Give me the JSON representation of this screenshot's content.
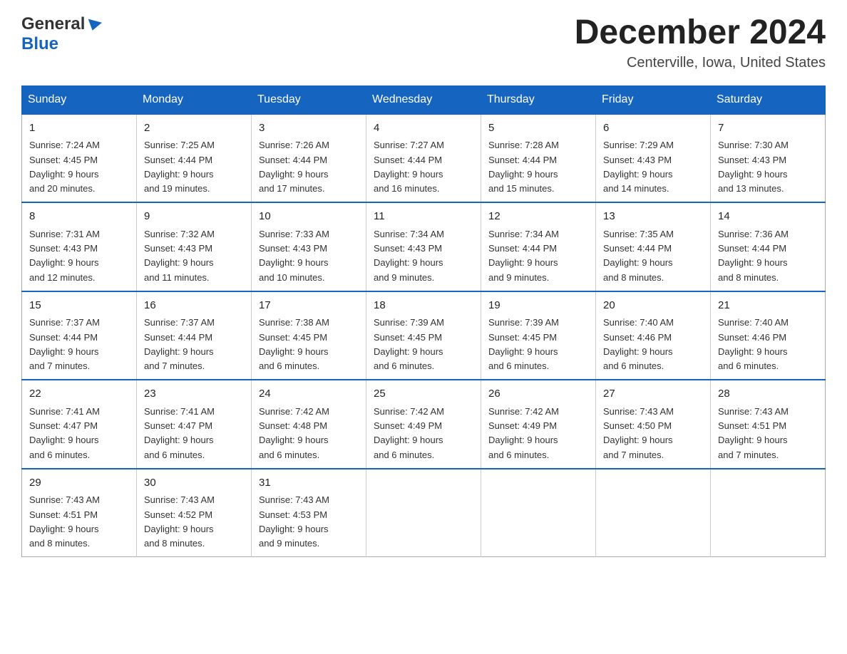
{
  "header": {
    "logo_general": "General",
    "logo_blue": "Blue",
    "month_title": "December 2024",
    "location": "Centerville, Iowa, United States"
  },
  "days_of_week": [
    "Sunday",
    "Monday",
    "Tuesday",
    "Wednesday",
    "Thursday",
    "Friday",
    "Saturday"
  ],
  "weeks": [
    [
      {
        "day": "1",
        "sunrise": "7:24 AM",
        "sunset": "4:45 PM",
        "daylight": "9 hours and 20 minutes."
      },
      {
        "day": "2",
        "sunrise": "7:25 AM",
        "sunset": "4:44 PM",
        "daylight": "9 hours and 19 minutes."
      },
      {
        "day": "3",
        "sunrise": "7:26 AM",
        "sunset": "4:44 PM",
        "daylight": "9 hours and 17 minutes."
      },
      {
        "day": "4",
        "sunrise": "7:27 AM",
        "sunset": "4:44 PM",
        "daylight": "9 hours and 16 minutes."
      },
      {
        "day": "5",
        "sunrise": "7:28 AM",
        "sunset": "4:44 PM",
        "daylight": "9 hours and 15 minutes."
      },
      {
        "day": "6",
        "sunrise": "7:29 AM",
        "sunset": "4:43 PM",
        "daylight": "9 hours and 14 minutes."
      },
      {
        "day": "7",
        "sunrise": "7:30 AM",
        "sunset": "4:43 PM",
        "daylight": "9 hours and 13 minutes."
      }
    ],
    [
      {
        "day": "8",
        "sunrise": "7:31 AM",
        "sunset": "4:43 PM",
        "daylight": "9 hours and 12 minutes."
      },
      {
        "day": "9",
        "sunrise": "7:32 AM",
        "sunset": "4:43 PM",
        "daylight": "9 hours and 11 minutes."
      },
      {
        "day": "10",
        "sunrise": "7:33 AM",
        "sunset": "4:43 PM",
        "daylight": "9 hours and 10 minutes."
      },
      {
        "day": "11",
        "sunrise": "7:34 AM",
        "sunset": "4:43 PM",
        "daylight": "9 hours and 9 minutes."
      },
      {
        "day": "12",
        "sunrise": "7:34 AM",
        "sunset": "4:44 PM",
        "daylight": "9 hours and 9 minutes."
      },
      {
        "day": "13",
        "sunrise": "7:35 AM",
        "sunset": "4:44 PM",
        "daylight": "9 hours and 8 minutes."
      },
      {
        "day": "14",
        "sunrise": "7:36 AM",
        "sunset": "4:44 PM",
        "daylight": "9 hours and 8 minutes."
      }
    ],
    [
      {
        "day": "15",
        "sunrise": "7:37 AM",
        "sunset": "4:44 PM",
        "daylight": "9 hours and 7 minutes."
      },
      {
        "day": "16",
        "sunrise": "7:37 AM",
        "sunset": "4:44 PM",
        "daylight": "9 hours and 7 minutes."
      },
      {
        "day": "17",
        "sunrise": "7:38 AM",
        "sunset": "4:45 PM",
        "daylight": "9 hours and 6 minutes."
      },
      {
        "day": "18",
        "sunrise": "7:39 AM",
        "sunset": "4:45 PM",
        "daylight": "9 hours and 6 minutes."
      },
      {
        "day": "19",
        "sunrise": "7:39 AM",
        "sunset": "4:45 PM",
        "daylight": "9 hours and 6 minutes."
      },
      {
        "day": "20",
        "sunrise": "7:40 AM",
        "sunset": "4:46 PM",
        "daylight": "9 hours and 6 minutes."
      },
      {
        "day": "21",
        "sunrise": "7:40 AM",
        "sunset": "4:46 PM",
        "daylight": "9 hours and 6 minutes."
      }
    ],
    [
      {
        "day": "22",
        "sunrise": "7:41 AM",
        "sunset": "4:47 PM",
        "daylight": "9 hours and 6 minutes."
      },
      {
        "day": "23",
        "sunrise": "7:41 AM",
        "sunset": "4:47 PM",
        "daylight": "9 hours and 6 minutes."
      },
      {
        "day": "24",
        "sunrise": "7:42 AM",
        "sunset": "4:48 PM",
        "daylight": "9 hours and 6 minutes."
      },
      {
        "day": "25",
        "sunrise": "7:42 AM",
        "sunset": "4:49 PM",
        "daylight": "9 hours and 6 minutes."
      },
      {
        "day": "26",
        "sunrise": "7:42 AM",
        "sunset": "4:49 PM",
        "daylight": "9 hours and 6 minutes."
      },
      {
        "day": "27",
        "sunrise": "7:43 AM",
        "sunset": "4:50 PM",
        "daylight": "9 hours and 7 minutes."
      },
      {
        "day": "28",
        "sunrise": "7:43 AM",
        "sunset": "4:51 PM",
        "daylight": "9 hours and 7 minutes."
      }
    ],
    [
      {
        "day": "29",
        "sunrise": "7:43 AM",
        "sunset": "4:51 PM",
        "daylight": "9 hours and 8 minutes."
      },
      {
        "day": "30",
        "sunrise": "7:43 AM",
        "sunset": "4:52 PM",
        "daylight": "9 hours and 8 minutes."
      },
      {
        "day": "31",
        "sunrise": "7:43 AM",
        "sunset": "4:53 PM",
        "daylight": "9 hours and 9 minutes."
      },
      null,
      null,
      null,
      null
    ]
  ],
  "labels": {
    "sunrise": "Sunrise:",
    "sunset": "Sunset:",
    "daylight": "Daylight:"
  }
}
